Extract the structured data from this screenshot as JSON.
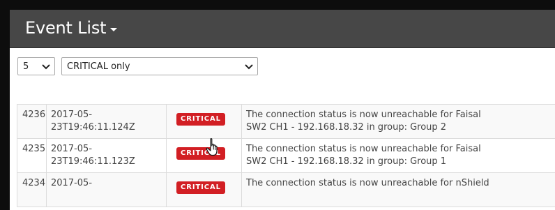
{
  "header": {
    "title": "Event List"
  },
  "filters": {
    "page_size": "5",
    "severity_filter": "CRITICAL only"
  },
  "colors": {
    "critical": "#d21f24",
    "header_bg": "#474747"
  },
  "events": [
    {
      "id": "4236",
      "time_line1": "2017-05-",
      "time_line2": "23T19:46:11.124Z",
      "severity": "CRITICAL",
      "message_line1": "The connection status is now unreachable for Faisal",
      "message_line2": "SW2 CH1 - 192.168.18.32 in group: Group 2"
    },
    {
      "id": "4235",
      "time_line1": "2017-05-",
      "time_line2": "23T19:46:11.123Z",
      "severity": "CRITICAL",
      "message_line1": "The connection status is now unreachable for Faisal",
      "message_line2": "SW2 CH1 - 192.168.18.32 in group: Group 1"
    },
    {
      "id": "4234",
      "time_line1": "2017-05-",
      "time_line2": "",
      "severity": "CRITICAL",
      "message_line1": "The connection status is now unreachable for nShield",
      "message_line2": ""
    }
  ],
  "icons": {
    "dropdown": "caret-down-icon",
    "select": "chevron-down-icon",
    "cursor": "hand-pointer-icon"
  }
}
